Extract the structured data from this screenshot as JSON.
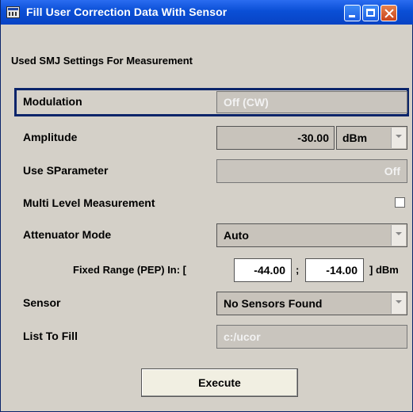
{
  "window": {
    "title": "Fill User Correction Data With Sensor",
    "titlebar_color": "#0a4fd6",
    "buttons": [
      "minimize-icon",
      "maximize-icon",
      "close-icon"
    ]
  },
  "section_title": "Used SMJ Settings For Measurement",
  "rows": {
    "modulation": {
      "label": "Modulation",
      "value": "Off (CW)"
    },
    "amplitude": {
      "label": "Amplitude",
      "value": "-30.00",
      "unit": "dBm"
    },
    "use_sparameter": {
      "label": "Use SParameter",
      "value": "Off"
    },
    "multi_level": {
      "label": "Multi Level Measurement",
      "checked": false
    },
    "attenuator_mode": {
      "label": "Attenuator Mode",
      "value": "Auto"
    },
    "fixed_range": {
      "label": "Fixed Range (PEP) In: [",
      "low": "-44.00",
      "separator": ";",
      "high": "-14.00",
      "suffix": "] dBm"
    },
    "sensor": {
      "label": "Sensor",
      "value": "No Sensors Found"
    },
    "list_to_fill": {
      "label": "List To Fill",
      "value": "c:/ucor"
    }
  },
  "execute_label": "Execute",
  "colors": {
    "focus_border": "#0a246a",
    "panel_bg": "#d4d0c8"
  }
}
